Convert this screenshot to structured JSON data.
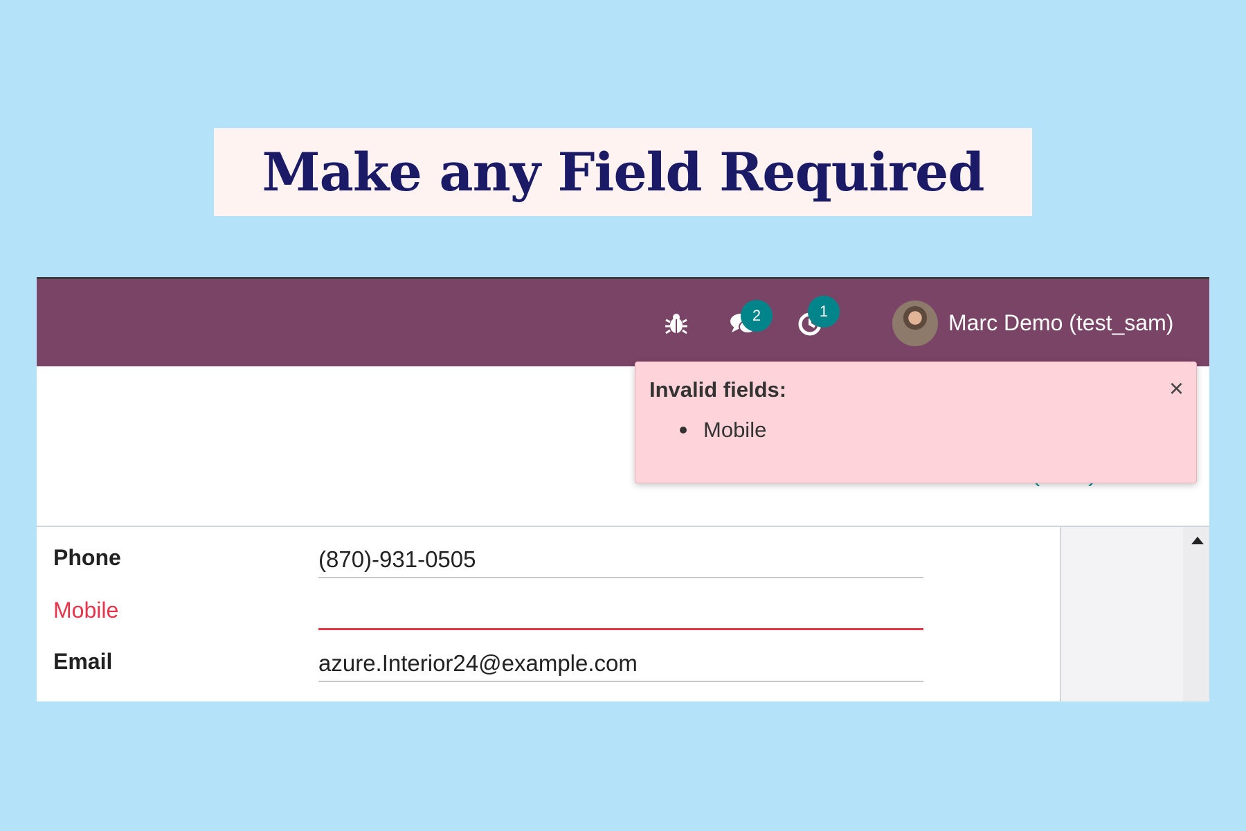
{
  "banner": {
    "title": "Make any Field Required"
  },
  "navbar": {
    "icons": [
      "bug-icon",
      "chat-icon",
      "clock-icon"
    ],
    "messages_badge": "2",
    "activities_badge": "1",
    "user_name": "Marc Demo (test_sam)",
    "background_color": "#7a4466",
    "badge_color": "#01848a"
  },
  "form": {
    "fields": [
      {
        "label": "Phone",
        "value": "(870)-931-0505",
        "invalid": false
      },
      {
        "label": "Mobile",
        "value": "",
        "invalid": true
      },
      {
        "label": "Email",
        "value": "azure.Interior24@example.com",
        "invalid": false
      }
    ],
    "invalid_color": "#e8334a"
  },
  "notification": {
    "title": "Invalid fields:",
    "items": [
      "Mobile"
    ],
    "close_label": "×",
    "background_color": "#ffd3da"
  }
}
